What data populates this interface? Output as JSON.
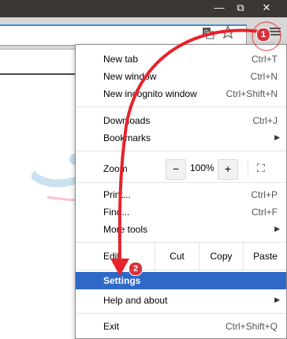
{
  "window": {
    "minimize": "—",
    "restore": "⧉",
    "close": "✕"
  },
  "toolbar": {
    "translate_icon": "translate-icon",
    "star_icon": "star-icon",
    "menu_icon": "hamburger-menu-icon"
  },
  "menu": {
    "new_tab": {
      "label": "New tab",
      "shortcut": "Ctrl+T"
    },
    "new_window": {
      "label": "New window",
      "shortcut": "Ctrl+N"
    },
    "incognito": {
      "label": "New incognito window",
      "shortcut": "Ctrl+Shift+N"
    },
    "downloads": {
      "label": "Downloads",
      "shortcut": "Ctrl+J"
    },
    "bookmarks": {
      "label": "Bookmarks"
    },
    "zoom": {
      "label": "Zoom",
      "minus": "−",
      "value": "100%",
      "plus": "+",
      "fullscreen": "⛶"
    },
    "print": {
      "label": "Print...",
      "shortcut": "Ctrl+P"
    },
    "find": {
      "label": "Find...",
      "shortcut": "Ctrl+F"
    },
    "more_tools": {
      "label": "More tools"
    },
    "edit": {
      "label": "Edit",
      "cut": "Cut",
      "copy": "Copy",
      "paste": "Paste"
    },
    "settings": {
      "label": "Settings"
    },
    "help": {
      "label": "Help and about"
    },
    "exit": {
      "label": "Exit",
      "shortcut": "Ctrl+Shift+Q"
    }
  },
  "annotations": {
    "step1": "1",
    "step2": "2"
  },
  "colors": {
    "selected": "#2f68c7",
    "arrow": "#e8222a",
    "badge": "#d9313c"
  }
}
